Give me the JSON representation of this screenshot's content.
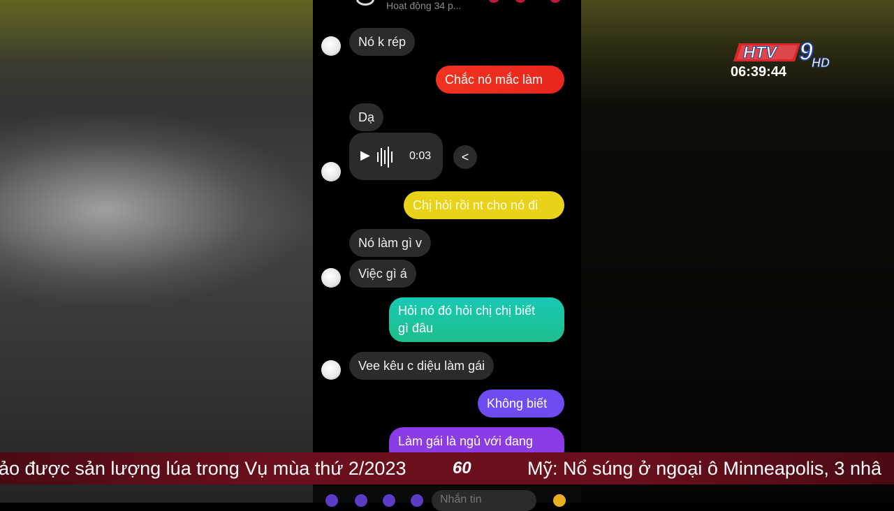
{
  "status": {
    "active_text": "Hoạt động 34 p..."
  },
  "messages": {
    "m1": "Nó k rép",
    "m2": "Chắc nó mắc làm",
    "m3": "Dạ",
    "m4_duration": "0:03",
    "m5": "Chị hỏi rồi nt cho nó đi",
    "m6": "Nó làm gì v",
    "m7": "Việc gì á",
    "m8_line1": "Hỏi nó đó hỏi chị chị biết",
    "m8_line2": "gì đâu",
    "m9": "Vee kêu c diệu làm gái",
    "m10": "Không biết",
    "m11": "Làm gái là ngủ với đang"
  },
  "composer": {
    "placeholder": "Nhắn tin"
  },
  "channel": {
    "logo": "HTV9",
    "hd": "HD",
    "clock": "06:39:44"
  },
  "ticker": {
    "left_text": "ảo được sản lượng lúa trong Vụ mùa thứ 2/2023",
    "logo": "60",
    "right_text": "Mỹ: Nổ súng ở ngoại ô Minneapolis, 3 nhâ"
  },
  "colors": {
    "red_bubble": "#f0331f",
    "yellow_bubble": "#e8d21a",
    "teal_bubble": "#1fc9a0",
    "purple_bubble": "#7a4bf0",
    "violet_bubble": "#8b3ce6",
    "ticker_bg": "#6a0f1c"
  }
}
